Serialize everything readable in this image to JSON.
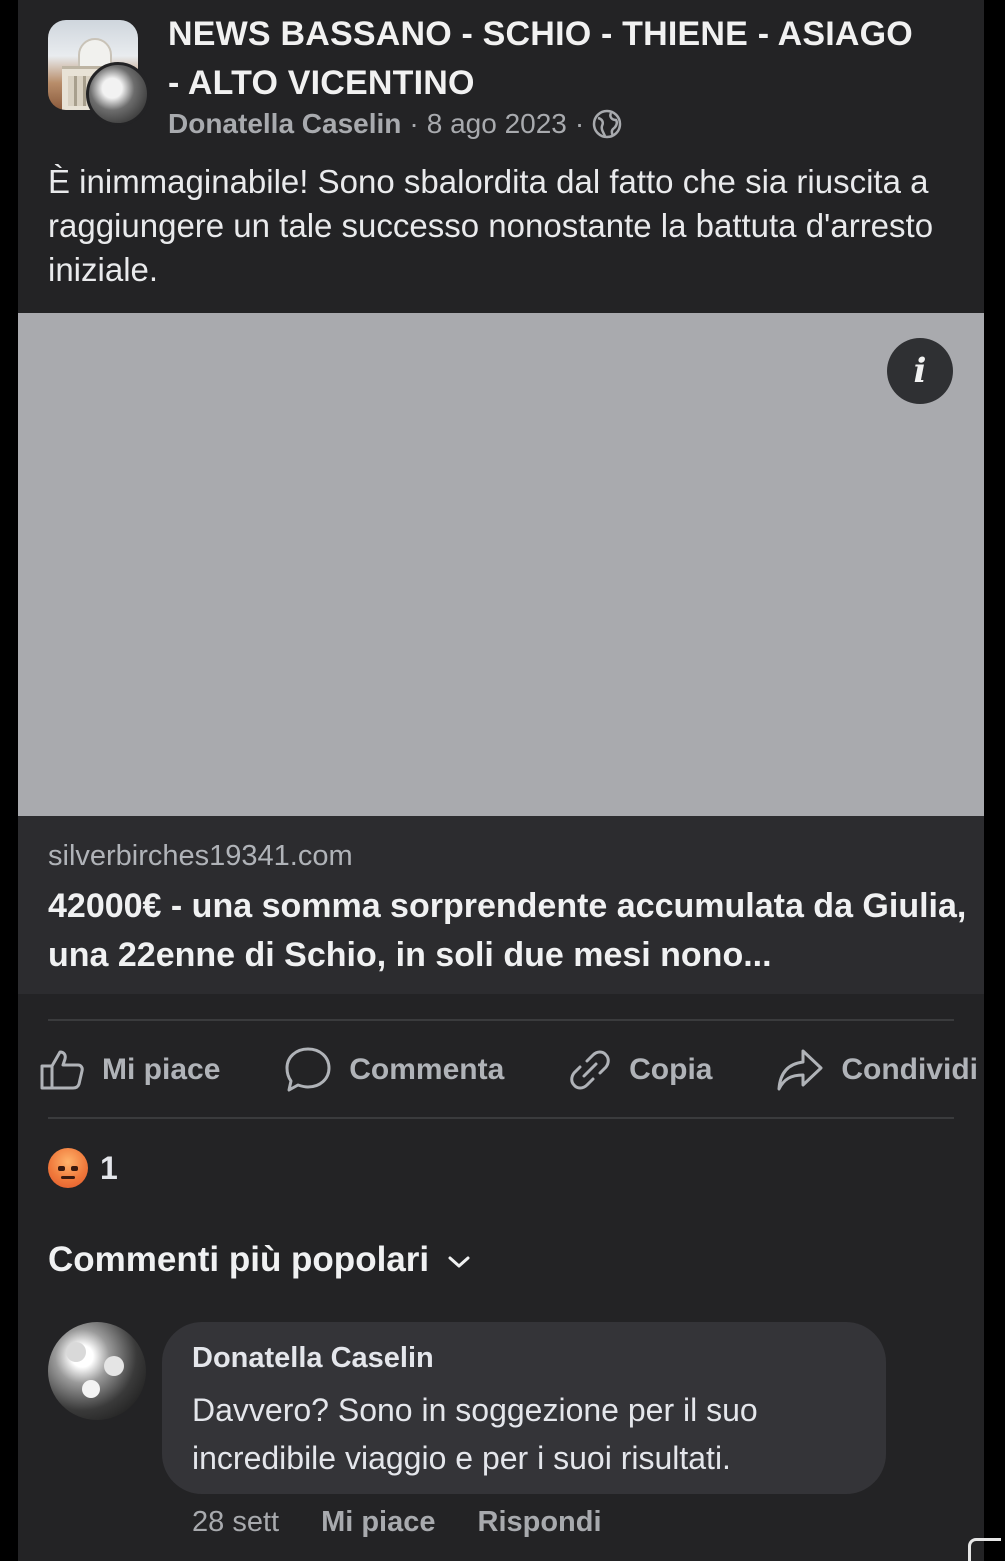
{
  "post": {
    "group_name": "NEWS BASSANO - SCHIO - THIENE - ASIAGO - ALTO VICENTINO",
    "author": "Donatella Caselin",
    "separator": "·",
    "date": "8 ago 2023",
    "privacy_icon": "globe-icon",
    "text": "È inimmaginabile! Sono sbalordita dal fatto che sia riuscita a raggiungere un tale successo nonostante la battuta d'arresto iniziale."
  },
  "link_preview": {
    "info_label": "i",
    "domain": "silverbirches19341.com",
    "title": "42000€ - una somma sorprendente accumulata da Giulia, una 22enne di Schio, in soli due mesi nono..."
  },
  "actions": {
    "like": "Mi piace",
    "comment": "Commenta",
    "copy": "Copia",
    "share": "Condividi"
  },
  "reactions": {
    "icon": "angry-reaction-icon",
    "count": "1"
  },
  "comments_sort": {
    "label": "Commenti più popolari"
  },
  "comment": {
    "author": "Donatella Caselin",
    "text": "Davvero? Sono in soggezione per il suo incredibile viaggio e per i suoi risultati.",
    "time": "28 sett",
    "like": "Mi piace",
    "reply": "Rispondi"
  },
  "colors": {
    "background": "#232325",
    "preview_image": "#a9aaae",
    "muted_text": "#b0b3b8",
    "bubble": "#343438"
  }
}
